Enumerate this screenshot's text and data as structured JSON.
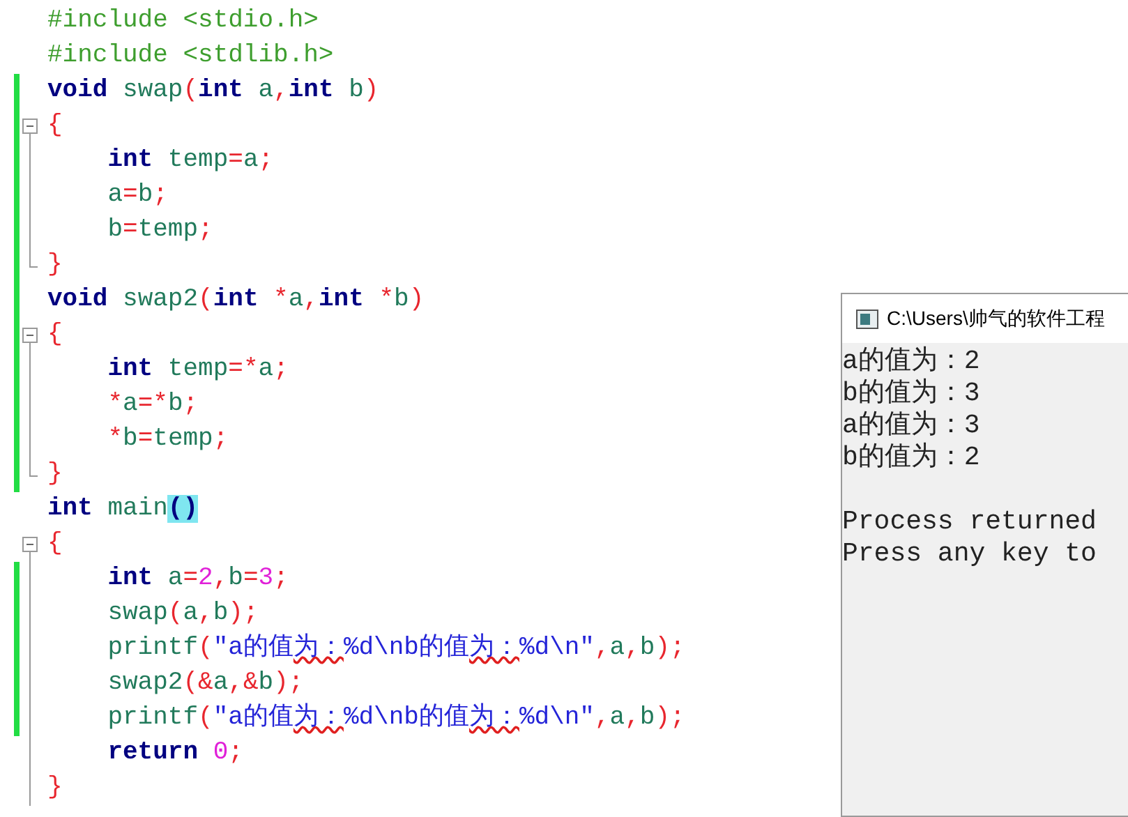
{
  "editor": {
    "lines": [
      {
        "changed": false,
        "kind": "plain",
        "tokens": [
          {
            "text": "#include <stdio.h>",
            "kind": "pre"
          }
        ]
      },
      {
        "changed": false,
        "kind": "plain",
        "tokens": [
          {
            "text": "#include <stdlib.h>",
            "kind": "pre"
          }
        ]
      },
      {
        "changed": true,
        "kind": "plain",
        "tokens": [
          {
            "text": "void",
            "kind": "kw"
          },
          {
            "text": " swap",
            "kind": "id"
          },
          {
            "text": "(",
            "kind": "op"
          },
          {
            "text": "int",
            "kind": "kw"
          },
          {
            "text": " a",
            "kind": "id"
          },
          {
            "text": ",",
            "kind": "op"
          },
          {
            "text": "int",
            "kind": "kw"
          },
          {
            "text": " b",
            "kind": "id"
          },
          {
            "text": ")",
            "kind": "op"
          }
        ]
      },
      {
        "changed": true,
        "kind": "fold_start",
        "tokens": [
          {
            "text": "{",
            "kind": "op"
          }
        ]
      },
      {
        "changed": true,
        "kind": "fold_mid",
        "tokens": [
          {
            "text": "    int",
            "kind": "kw"
          },
          {
            "text": " temp",
            "kind": "id"
          },
          {
            "text": "=",
            "kind": "op"
          },
          {
            "text": "a",
            "kind": "id"
          },
          {
            "text": ";",
            "kind": "op"
          }
        ]
      },
      {
        "changed": true,
        "kind": "fold_mid",
        "tokens": [
          {
            "text": "    a",
            "kind": "id"
          },
          {
            "text": "=",
            "kind": "op"
          },
          {
            "text": "b",
            "kind": "id"
          },
          {
            "text": ";",
            "kind": "op"
          }
        ]
      },
      {
        "changed": true,
        "kind": "fold_mid",
        "tokens": [
          {
            "text": "    b",
            "kind": "id"
          },
          {
            "text": "=",
            "kind": "op"
          },
          {
            "text": "temp",
            "kind": "id"
          },
          {
            "text": ";",
            "kind": "op"
          }
        ]
      },
      {
        "changed": true,
        "kind": "fold_end",
        "tokens": [
          {
            "text": "}",
            "kind": "op"
          }
        ]
      },
      {
        "changed": true,
        "kind": "plain",
        "tokens": [
          {
            "text": "void",
            "kind": "kw"
          },
          {
            "text": " swap2",
            "kind": "id"
          },
          {
            "text": "(",
            "kind": "op"
          },
          {
            "text": "int",
            "kind": "kw"
          },
          {
            "text": " *",
            "kind": "op"
          },
          {
            "text": "a",
            "kind": "id"
          },
          {
            "text": ",",
            "kind": "op"
          },
          {
            "text": "int",
            "kind": "kw"
          },
          {
            "text": " *",
            "kind": "op"
          },
          {
            "text": "b",
            "kind": "id"
          },
          {
            "text": ")",
            "kind": "op"
          }
        ]
      },
      {
        "changed": true,
        "kind": "fold_start",
        "tokens": [
          {
            "text": "{",
            "kind": "op"
          }
        ]
      },
      {
        "changed": true,
        "kind": "fold_mid",
        "tokens": [
          {
            "text": "    int",
            "kind": "kw"
          },
          {
            "text": " temp",
            "kind": "id"
          },
          {
            "text": "=*",
            "kind": "op"
          },
          {
            "text": "a",
            "kind": "id"
          },
          {
            "text": ";",
            "kind": "op"
          }
        ]
      },
      {
        "changed": true,
        "kind": "fold_mid",
        "tokens": [
          {
            "text": "    *",
            "kind": "op"
          },
          {
            "text": "a",
            "kind": "id"
          },
          {
            "text": "=*",
            "kind": "op"
          },
          {
            "text": "b",
            "kind": "id"
          },
          {
            "text": ";",
            "kind": "op"
          }
        ]
      },
      {
        "changed": true,
        "kind": "fold_mid",
        "tokens": [
          {
            "text": "    *",
            "kind": "op"
          },
          {
            "text": "b",
            "kind": "id"
          },
          {
            "text": "=",
            "kind": "op"
          },
          {
            "text": "temp",
            "kind": "id"
          },
          {
            "text": ";",
            "kind": "op"
          }
        ]
      },
      {
        "changed": true,
        "kind": "fold_end",
        "tokens": [
          {
            "text": "}",
            "kind": "op"
          }
        ]
      },
      {
        "changed": false,
        "kind": "plain",
        "tokens": [
          {
            "text": "int",
            "kind": "kw"
          },
          {
            "text": " main",
            "kind": "id"
          },
          {
            "text": "()",
            "kind": "match"
          }
        ]
      },
      {
        "changed": false,
        "kind": "fold_start",
        "tokens": [
          {
            "text": "{",
            "kind": "op"
          }
        ]
      },
      {
        "changed": true,
        "kind": "fold_mid",
        "tokens": [
          {
            "text": "    int",
            "kind": "kw"
          },
          {
            "text": " a",
            "kind": "id"
          },
          {
            "text": "=",
            "kind": "op"
          },
          {
            "text": "2",
            "kind": "num"
          },
          {
            "text": ",",
            "kind": "op"
          },
          {
            "text": "b",
            "kind": "id"
          },
          {
            "text": "=",
            "kind": "op"
          },
          {
            "text": "3",
            "kind": "num"
          },
          {
            "text": ";",
            "kind": "op"
          }
        ]
      },
      {
        "changed": true,
        "kind": "fold_mid",
        "tokens": [
          {
            "text": "    swap",
            "kind": "id"
          },
          {
            "text": "(",
            "kind": "op"
          },
          {
            "text": "a",
            "kind": "id"
          },
          {
            "text": ",",
            "kind": "op"
          },
          {
            "text": "b",
            "kind": "id"
          },
          {
            "text": ");",
            "kind": "op"
          }
        ]
      },
      {
        "changed": true,
        "kind": "fold_mid",
        "tokens": [
          {
            "text": "    printf",
            "kind": "id"
          },
          {
            "text": "(",
            "kind": "op"
          },
          {
            "text": "\"a的值",
            "kind": "str"
          },
          {
            "text": "为：",
            "kind": "strw"
          },
          {
            "text": "%d\\nb的值",
            "kind": "str"
          },
          {
            "text": "为：",
            "kind": "strw"
          },
          {
            "text": "%d\\n\"",
            "kind": "str"
          },
          {
            "text": ",",
            "kind": "op"
          },
          {
            "text": "a",
            "kind": "id"
          },
          {
            "text": ",",
            "kind": "op"
          },
          {
            "text": "b",
            "kind": "id"
          },
          {
            "text": ");",
            "kind": "op"
          }
        ]
      },
      {
        "changed": true,
        "kind": "fold_mid",
        "tokens": [
          {
            "text": "    swap2",
            "kind": "id"
          },
          {
            "text": "(&",
            "kind": "op"
          },
          {
            "text": "a",
            "kind": "id"
          },
          {
            "text": ",&",
            "kind": "op"
          },
          {
            "text": "b",
            "kind": "id"
          },
          {
            "text": ");",
            "kind": "op"
          }
        ]
      },
      {
        "changed": true,
        "kind": "fold_mid",
        "tokens": [
          {
            "text": "    printf",
            "kind": "id"
          },
          {
            "text": "(",
            "kind": "op"
          },
          {
            "text": "\"a的值",
            "kind": "str"
          },
          {
            "text": "为：",
            "kind": "strw"
          },
          {
            "text": "%d\\nb的值",
            "kind": "str"
          },
          {
            "text": "为：",
            "kind": "strw"
          },
          {
            "text": "%d\\n\"",
            "kind": "str"
          },
          {
            "text": ",",
            "kind": "op"
          },
          {
            "text": "a",
            "kind": "id"
          },
          {
            "text": ",",
            "kind": "op"
          },
          {
            "text": "b",
            "kind": "id"
          },
          {
            "text": ");",
            "kind": "op"
          }
        ]
      },
      {
        "changed": false,
        "kind": "fold_mid",
        "tokens": [
          {
            "text": "    return",
            "kind": "kw"
          },
          {
            "text": " 0",
            "kind": "num"
          },
          {
            "text": ";",
            "kind": "op"
          }
        ]
      },
      {
        "changed": false,
        "kind": "fold_mid",
        "tokens": [
          {
            "text": "}",
            "kind": "op"
          }
        ]
      }
    ]
  },
  "console": {
    "title": "C:\\Users\\帅气的软件工程",
    "output_blocks": [
      [
        "a的值为：2",
        "b的值为：3",
        "a的值为：3",
        "b的值为：2"
      ],
      [
        "Process returned",
        "Press any key to"
      ]
    ]
  }
}
